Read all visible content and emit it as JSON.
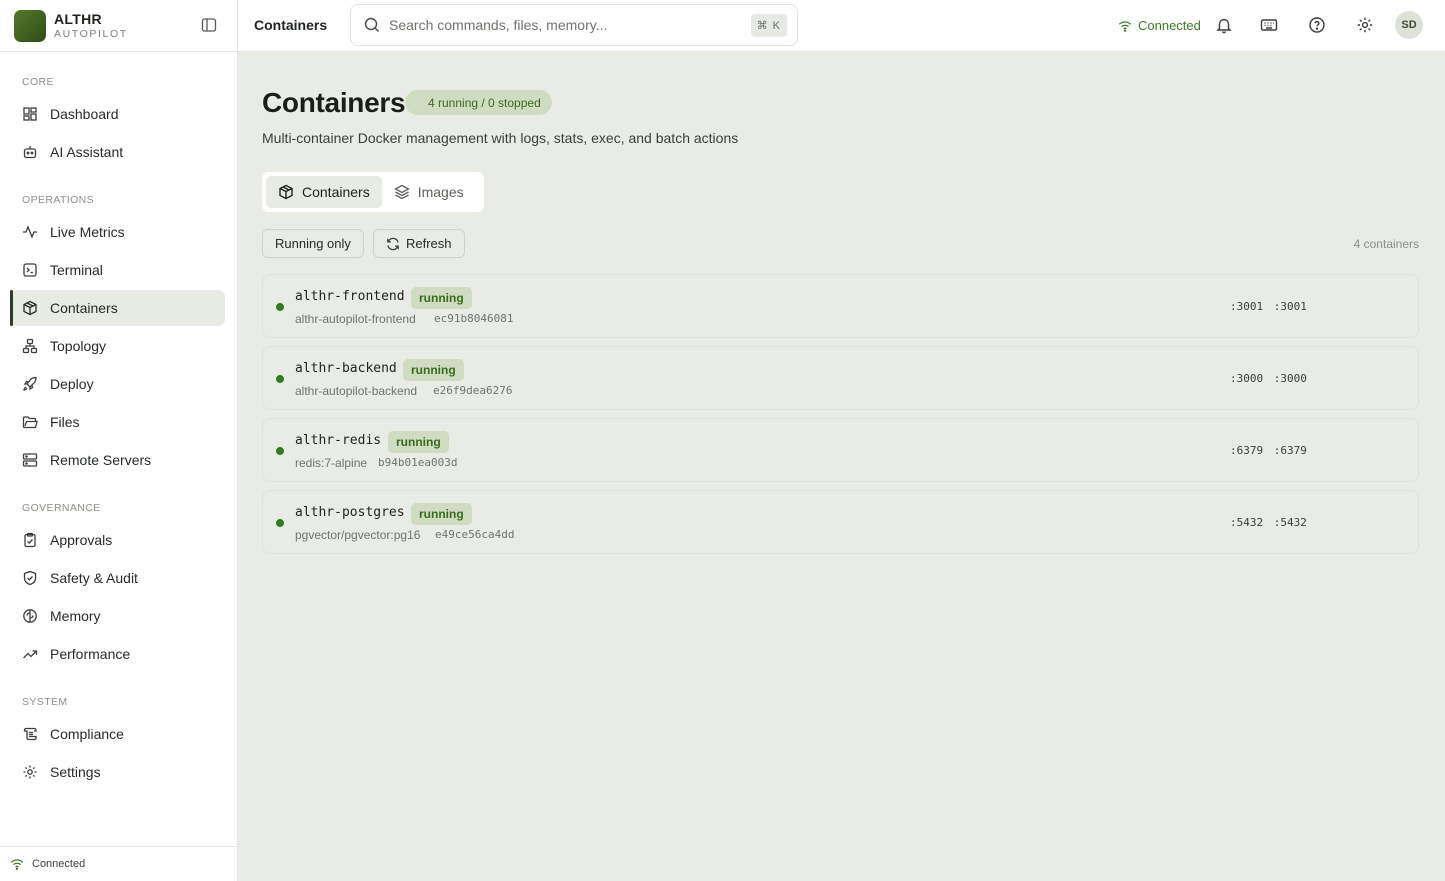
{
  "brand": {
    "name": "ALTHR",
    "sub": "AUTOPILOT"
  },
  "sidebar": {
    "sections": [
      {
        "label": "CORE",
        "items": [
          {
            "label": "Dashboard",
            "icon": "grid-icon"
          },
          {
            "label": "AI Assistant",
            "icon": "bot-icon"
          }
        ]
      },
      {
        "label": "OPERATIONS",
        "items": [
          {
            "label": "Live Metrics",
            "icon": "activity-icon"
          },
          {
            "label": "Terminal",
            "icon": "terminal-icon"
          },
          {
            "label": "Containers",
            "icon": "box-icon",
            "active": true
          },
          {
            "label": "Topology",
            "icon": "network-icon"
          },
          {
            "label": "Deploy",
            "icon": "rocket-icon"
          },
          {
            "label": "Files",
            "icon": "folder-icon"
          },
          {
            "label": "Remote Servers",
            "icon": "server-icon"
          }
        ]
      },
      {
        "label": "GOVERNANCE",
        "items": [
          {
            "label": "Approvals",
            "icon": "clipboard-icon"
          },
          {
            "label": "Safety & Audit",
            "icon": "shield-icon"
          },
          {
            "label": "Memory",
            "icon": "brain-icon"
          },
          {
            "label": "Performance",
            "icon": "trending-up-icon"
          }
        ]
      },
      {
        "label": "SYSTEM",
        "items": [
          {
            "label": "Compliance",
            "icon": "scroll-icon"
          },
          {
            "label": "Settings",
            "icon": "gear-icon"
          }
        ]
      }
    ],
    "footer_status": "Connected"
  },
  "header": {
    "title": "Containers",
    "search_placeholder": "Search commands, files, memory...",
    "shortcut": "⌘ K",
    "status": "Connected",
    "avatar": "SD"
  },
  "page": {
    "title": "Containers",
    "count_pill": "4 running / 0 stopped",
    "description": "Multi-container Docker management with logs, stats, exec, and batch actions",
    "tabs": [
      {
        "label": "Containers",
        "active": true
      },
      {
        "label": "Images",
        "active": false
      }
    ],
    "running_only_label": "Running only",
    "refresh_label": "Refresh",
    "total_count": "4 containers"
  },
  "containers": [
    {
      "name": "althr-frontend",
      "status": "running",
      "image": "althr-autopilot-frontend",
      "id": "ec91b8046081",
      "ports": ":3001 :3001"
    },
    {
      "name": "althr-backend",
      "status": "running",
      "image": "althr-autopilot-backend",
      "id": "e26f9dea6276",
      "ports": ":3000 :3000"
    },
    {
      "name": "althr-redis",
      "status": "running",
      "image": "redis:7-alpine",
      "id": "b94b01ea003d",
      "ports": ":6379 :6379"
    },
    {
      "name": "althr-postgres",
      "status": "running",
      "image": "pgvector/pgvector:pg16",
      "id": "e49ce56ca4dd",
      "ports": ":5432 :5432"
    }
  ],
  "colors": {
    "accent": "#3d7a25",
    "running_bg": "#cfdcc2",
    "status_dot": "#2f7d1e"
  }
}
